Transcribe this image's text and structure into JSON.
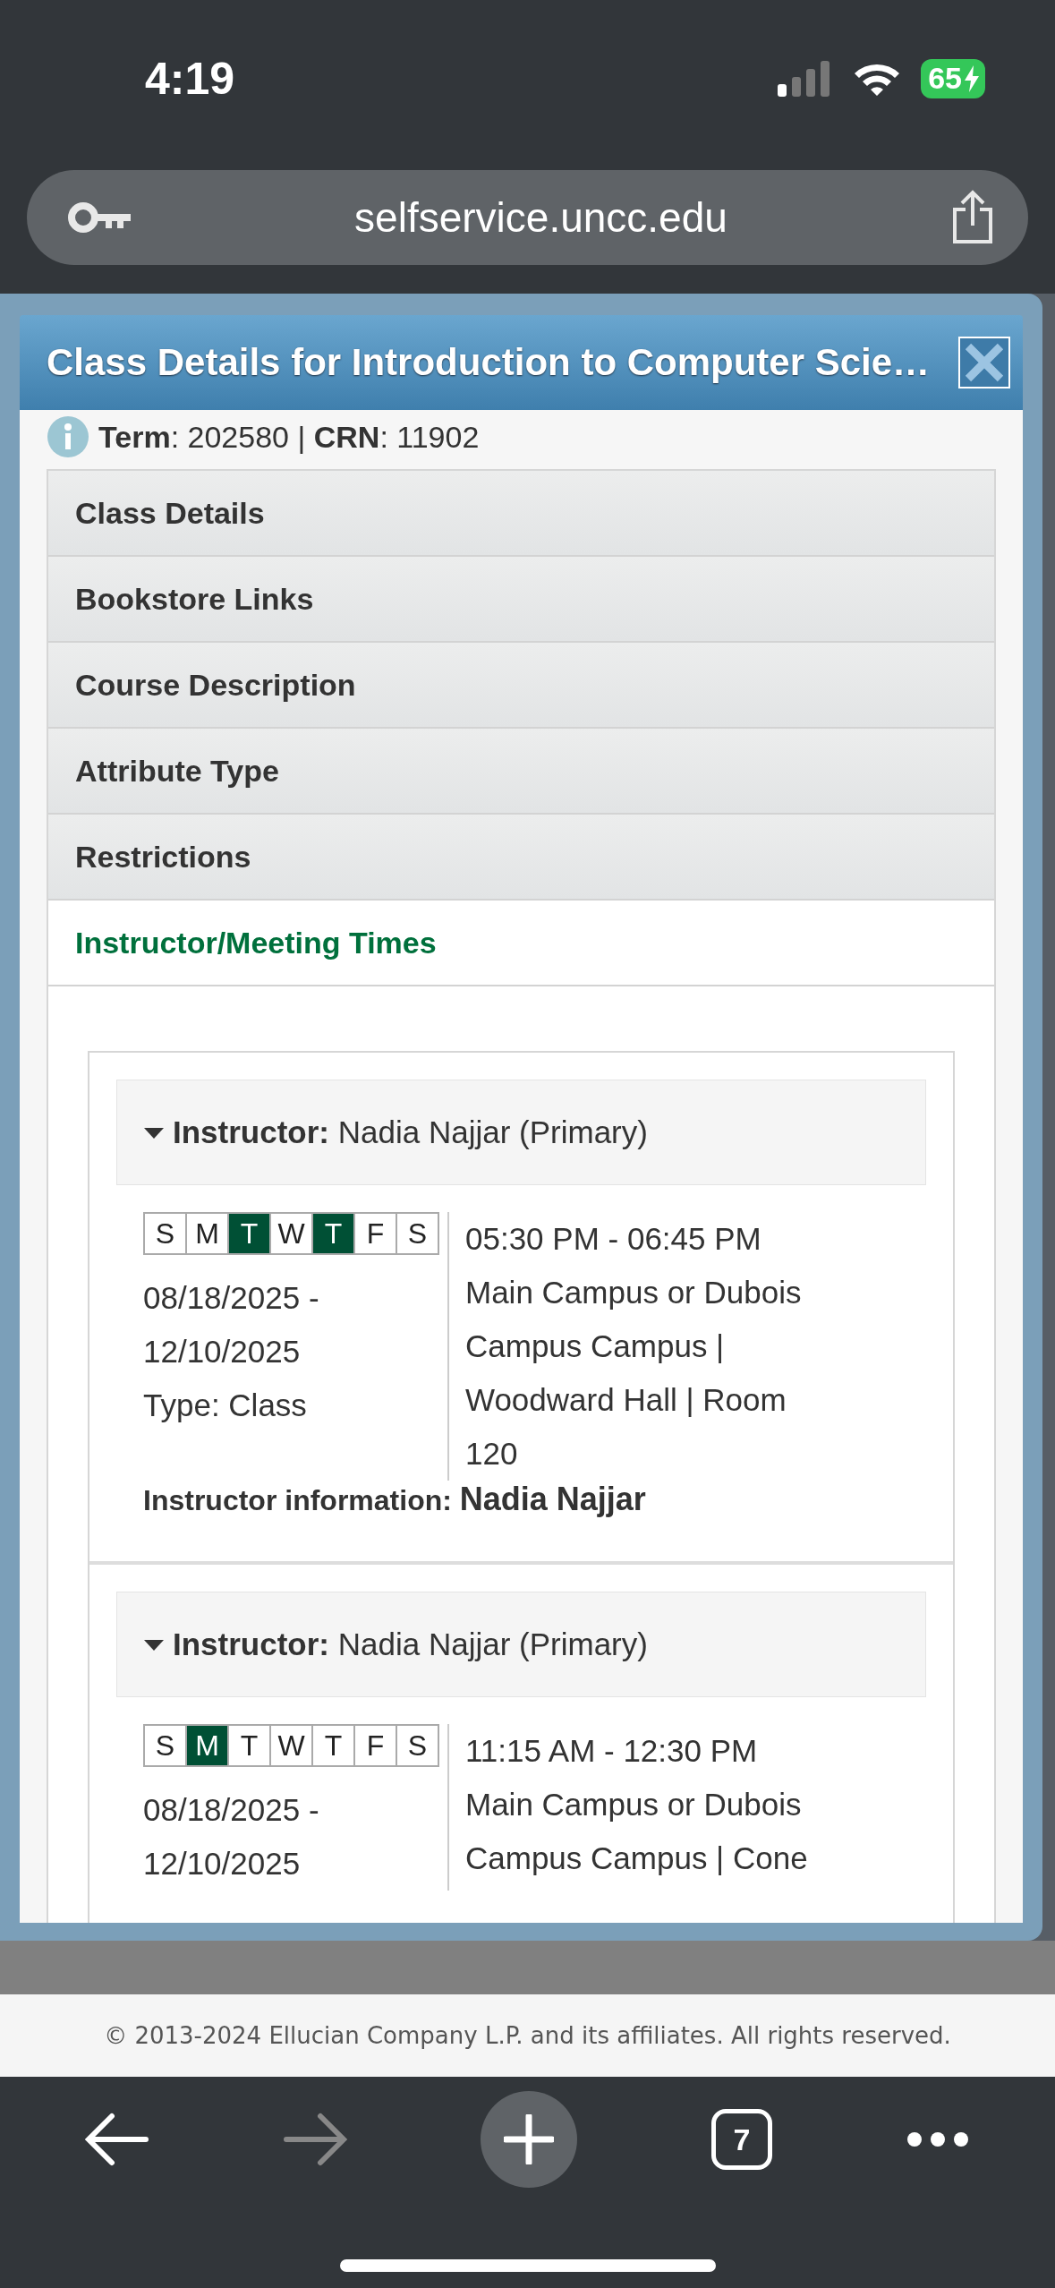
{
  "status_bar": {
    "time": "4:19",
    "battery": "65"
  },
  "browser": {
    "url": "selfservice.uncc.edu"
  },
  "dialog": {
    "title": "Class Details for Introduction to Computer Scie…",
    "info": "**Term**: 202580 | **CRN**: 11902",
    "sections": [
      {
        "label": "Class Details",
        "selected": false
      },
      {
        "label": "Bookstore Links",
        "selected": false
      },
      {
        "label": "Course Description",
        "selected": false
      },
      {
        "label": "Attribute Type",
        "selected": false
      },
      {
        "label": "Restrictions",
        "selected": false
      },
      {
        "label": "Instructor/Meeting Times",
        "selected": true
      }
    ],
    "meetings": [
      {
        "instructor_label": "Instructor:",
        "instructor": "Nadia Najjar (Primary)",
        "days": [
          {
            "letter": "S",
            "selected": false
          },
          {
            "letter": "M",
            "selected": false
          },
          {
            "letter": "T",
            "selected": true
          },
          {
            "letter": "W",
            "selected": false
          },
          {
            "letter": "T",
            "selected": true
          },
          {
            "letter": "F",
            "selected": false
          },
          {
            "letter": "S",
            "selected": false
          }
        ],
        "dates": [
          "08/18/2025 -",
          "12/10/2025"
        ],
        "type": "Type: Class",
        "time": "05:30 PM - 06:45 PM",
        "location": [
          "Main Campus or Dubois",
          "Campus Campus |",
          "Woodward Hall | Room",
          "120"
        ],
        "info_label": "Instructor information:",
        "info_name": "Nadia Najjar"
      },
      {
        "instructor_label": "Instructor:",
        "instructor": "Nadia Najjar (Primary)",
        "days": [
          {
            "letter": "S",
            "selected": false
          },
          {
            "letter": "M",
            "selected": true
          },
          {
            "letter": "T",
            "selected": false
          },
          {
            "letter": "W",
            "selected": false
          },
          {
            "letter": "T",
            "selected": false
          },
          {
            "letter": "F",
            "selected": false
          },
          {
            "letter": "S",
            "selected": false
          }
        ],
        "dates": [
          "08/18/2025 -",
          "12/10/2025"
        ],
        "time": "11:15 AM - 12:30 PM",
        "location": [
          "Main Campus or Dubois",
          "Campus Campus | Cone"
        ]
      }
    ]
  },
  "footer": {
    "copyright": "© 2013-2024 Ellucian Company L.P. and its affiliates. All rights reserved."
  },
  "nav": {
    "tab_count": "7"
  }
}
